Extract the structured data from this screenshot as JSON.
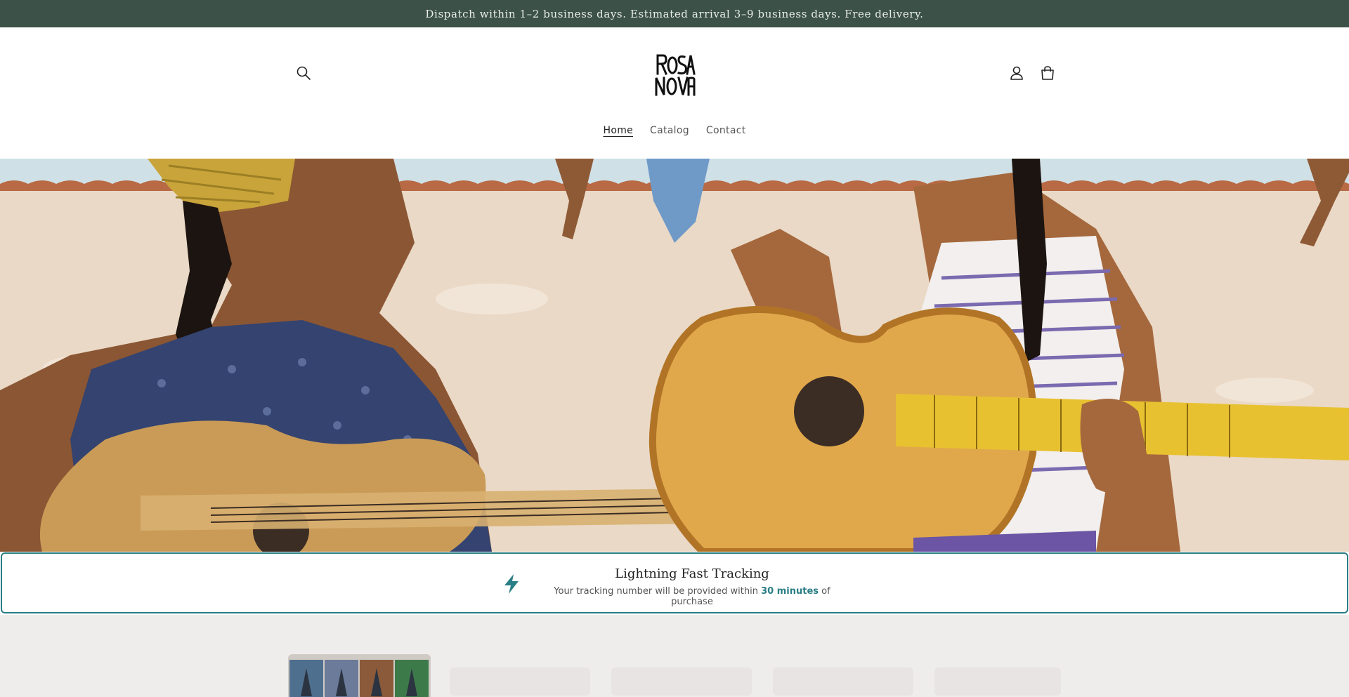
{
  "announcement": {
    "text": "Dispatch within 1–2 business days. Estimated arrival 3–9 business days. Free delivery."
  },
  "header": {
    "logo_text": "ROSA NOVA",
    "search_icon": "search-icon",
    "account_icon": "account-icon",
    "cart_icon": "cart-icon"
  },
  "nav": {
    "items": [
      {
        "label": "Home",
        "active": true
      },
      {
        "label": "Catalog",
        "active": false
      },
      {
        "label": "Contact",
        "active": false
      }
    ]
  },
  "tracking": {
    "icon": "lightning-icon",
    "title": "Lightning Fast Tracking",
    "subtitle_before": "Your tracking number will be provided within",
    "subtitle_highlight": "30 minutes",
    "subtitle_after": "of purchase",
    "accent_color": "#2a7e85"
  },
  "colors": {
    "announcement_bg": "#3c5148",
    "accent": "#2a7e85"
  }
}
